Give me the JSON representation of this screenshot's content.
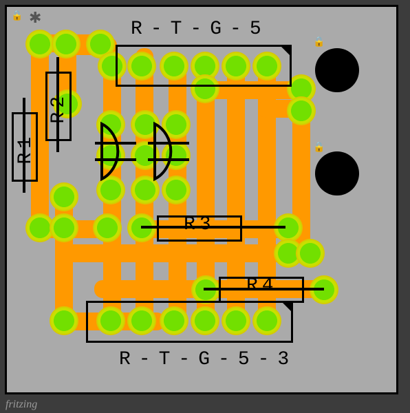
{
  "app": {
    "watermark": "fritzing"
  },
  "pcb": {
    "labels": {
      "top": "R-T-G-5",
      "bottom": "R-T-G-5-3"
    }
  },
  "components": {
    "R1": "R1",
    "R2": "R2",
    "R3": "R3",
    "R4": "R4"
  },
  "icons": {
    "topLock": "🔒",
    "topNotch": "✱",
    "lock1": "🔒",
    "lock2": "🔒"
  }
}
